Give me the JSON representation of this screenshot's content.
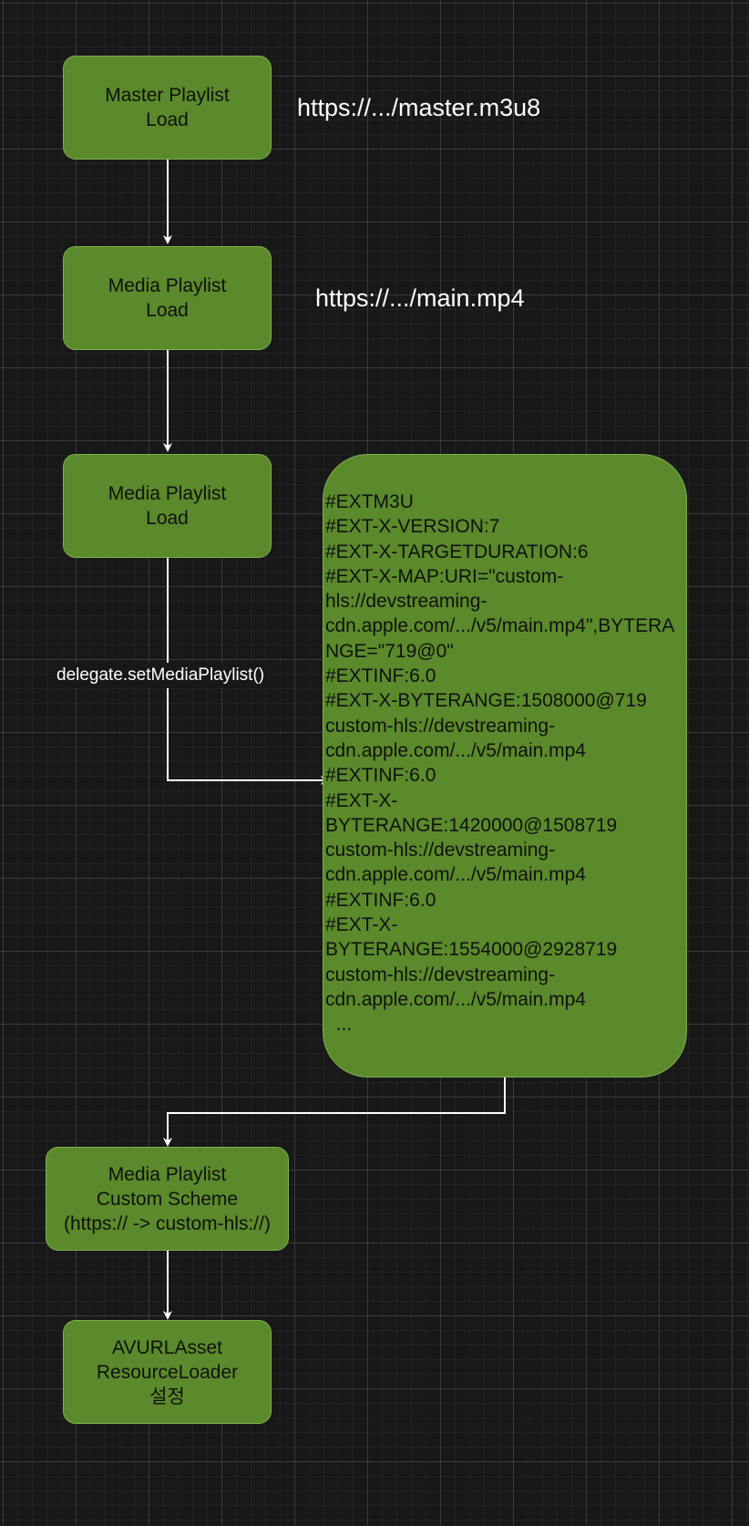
{
  "diagram": {
    "nodes": {
      "master_playlist": "Master Playlist\nLoad",
      "media_playlist_1": "Media Playlist\nLoad",
      "media_playlist_2": "Media Playlist\nLoad",
      "custom_scheme": "Media Playlist\nCustom Scheme\n(https:// -> custom-hls://)",
      "avurlasset": "AVURLAsset\nResourceLoader\n설정"
    },
    "playlist_content": "#EXTM3U\n#EXT-X-VERSION:7\n#EXT-X-TARGETDURATION:6\n#EXT-X-MAP:URI=\"custom-\nhls://devstreaming-\ncdn.apple.com/.../v5/main.mp4\",BYTERA\nNGE=\"719@0\"\n#EXTINF:6.0\n#EXT-X-BYTERANGE:1508000@719\ncustom-hls://devstreaming-\ncdn.apple.com/.../v5/main.mp4\n#EXTINF:6.0\n#EXT-X-\nBYTERANGE:1420000@1508719\ncustom-hls://devstreaming-\ncdn.apple.com/.../v5/main.mp4\n#EXTINF:6.0\n#EXT-X-\nBYTERANGE:1554000@2928719\ncustom-hls://devstreaming-\ncdn.apple.com/.../v5/main.mp4\n  ...",
    "url_labels": {
      "master": "https://.../master.m3u8",
      "media": "https://.../main.mp4"
    },
    "edge_labels": {
      "delegate": "delegate.setMediaPlaylist()"
    }
  },
  "colors": {
    "node_fill": "#5a8a2b",
    "node_border": "#7db050",
    "background": "#181818",
    "connector": "#ffffff"
  }
}
